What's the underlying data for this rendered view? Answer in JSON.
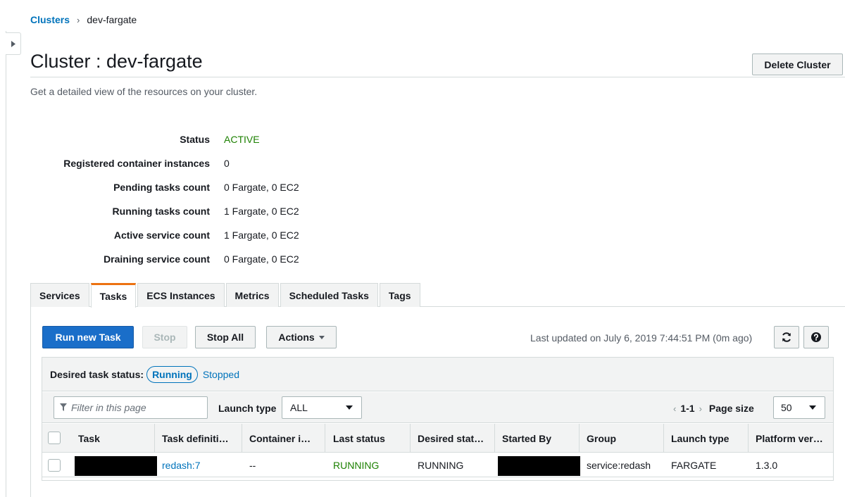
{
  "breadcrumb": {
    "root": "Clusters",
    "separator": "›",
    "current": "dev-fargate"
  },
  "page": {
    "title": "Cluster : dev-fargate",
    "subtitle": "Get a detailed view of the resources on your cluster.",
    "delete_label": "Delete Cluster"
  },
  "details": [
    {
      "label": "Status",
      "value": "ACTIVE"
    },
    {
      "label": "Registered container instances",
      "value": "0"
    },
    {
      "label": "Pending tasks count",
      "value": "0 Fargate, 0 EC2"
    },
    {
      "label": "Running tasks count",
      "value": "1 Fargate, 0 EC2"
    },
    {
      "label": "Active service count",
      "value": "1 Fargate, 0 EC2"
    },
    {
      "label": "Draining service count",
      "value": "0 Fargate, 0 EC2"
    }
  ],
  "tabs": [
    "Services",
    "Tasks",
    "ECS Instances",
    "Metrics",
    "Scheduled Tasks",
    "Tags"
  ],
  "active_tab": "Tasks",
  "toolbar": {
    "run_label": "Run new Task",
    "stop_label": "Stop",
    "stop_all_label": "Stop All",
    "actions_label": "Actions",
    "last_updated": "Last updated on July 6, 2019 7:44:51 PM (0m ago)"
  },
  "desired_status": {
    "label": "Desired task status:",
    "running": "Running",
    "stopped": "Stopped"
  },
  "filter": {
    "placeholder": "Filter in this page",
    "launch_label": "Launch type",
    "launch_value": "ALL",
    "range": "1-1",
    "page_size_label": "Page size",
    "page_size": "50",
    "prev": "‹",
    "next": "›"
  },
  "table": {
    "columns": [
      "Task",
      "Task definiti…",
      "Container i…",
      "Last status",
      "Desired stat…",
      "Started By",
      "Group",
      "Launch type",
      "Platform ver…"
    ],
    "rows": [
      {
        "task_definition": "redash:7",
        "container_instance": "--",
        "last_status": "RUNNING",
        "desired_status": "RUNNING",
        "group": "service:redash",
        "launch_type": "FARGATE",
        "platform_version": "1.3.0"
      }
    ]
  },
  "colors": {
    "accent": "#0073bb",
    "primary_button": "#1a6ec9",
    "active_green": "#1d8102",
    "tab_highlight": "#ec7211"
  },
  "icons": {
    "filter": "funnel-icon",
    "refresh": "refresh-icon",
    "help": "help-icon",
    "caret": "caret-down-icon",
    "sidebar": "caret-right-icon"
  }
}
